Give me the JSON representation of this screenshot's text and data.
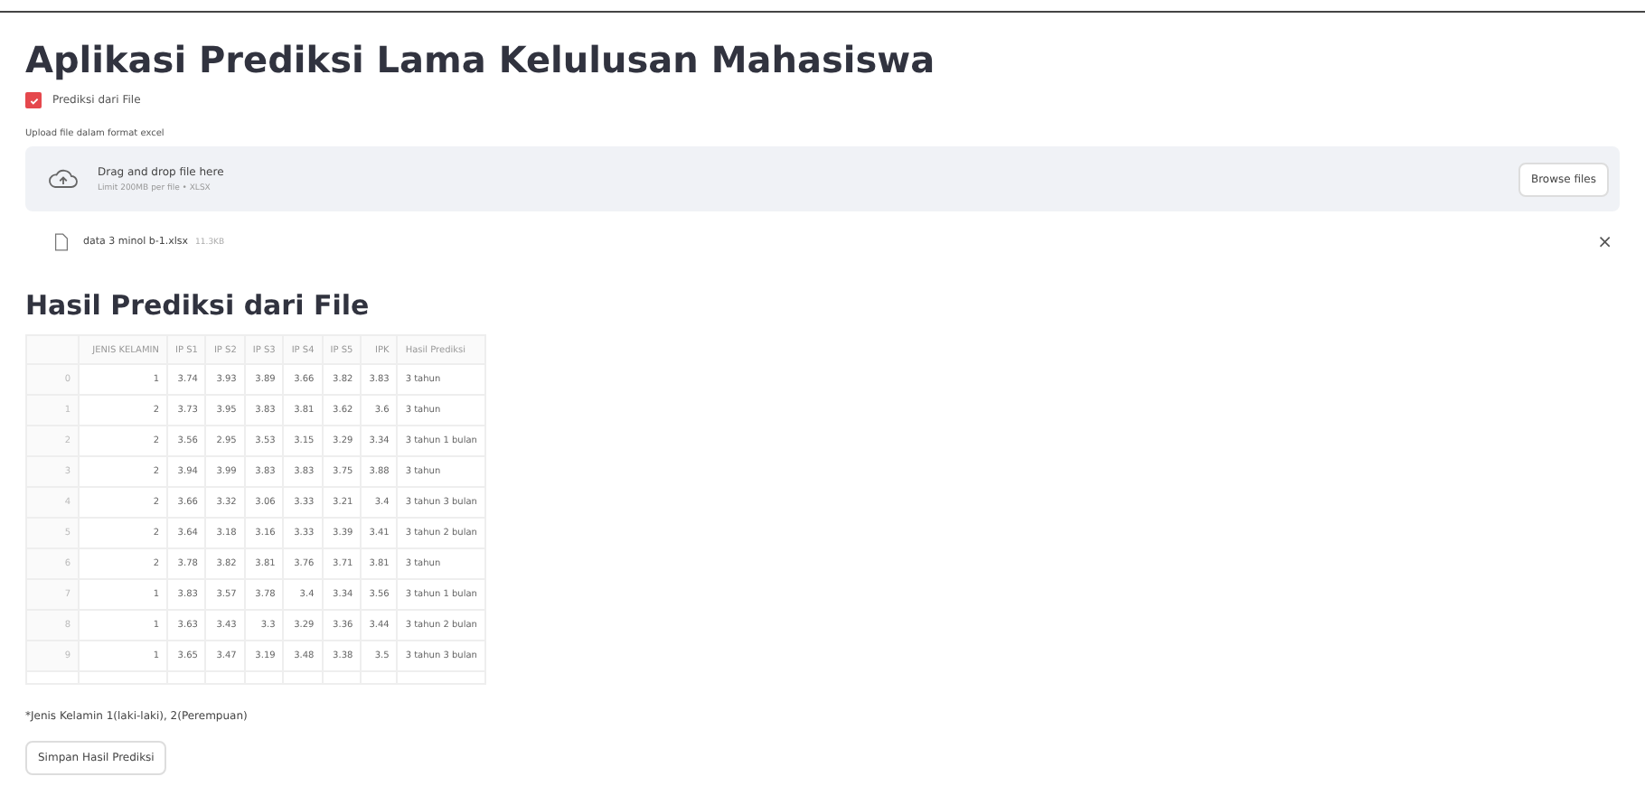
{
  "title": "Aplikasi Prediksi Lama Kelulusan Mahasiswa",
  "checkbox": {
    "label": "Prediksi dari File",
    "checked": true
  },
  "uploader": {
    "label": "Upload file dalam format excel",
    "drop_text": "Drag and drop file here",
    "limit": "Limit 200MB per file • XLSX",
    "button": "Browse files"
  },
  "file": {
    "name": "data 3 minol b-1.xlsx",
    "size": "11.3KB",
    "remove": "×"
  },
  "section_title": "Hasil Prediksi dari File",
  "table": {
    "columns": [
      "",
      "JENIS KELAMIN",
      "IP S1",
      "IP S2",
      "IP S3",
      "IP S4",
      "IP S5",
      "IPK",
      "Hasil Prediksi"
    ],
    "rows": [
      [
        "0",
        "1",
        "3.74",
        "3.93",
        "3.89",
        "3.66",
        "3.82",
        "3.83",
        "3 tahun"
      ],
      [
        "1",
        "2",
        "3.73",
        "3.95",
        "3.83",
        "3.81",
        "3.62",
        "3.6",
        "3 tahun"
      ],
      [
        "2",
        "2",
        "3.56",
        "2.95",
        "3.53",
        "3.15",
        "3.29",
        "3.34",
        "3 tahun 1 bulan"
      ],
      [
        "3",
        "2",
        "3.94",
        "3.99",
        "3.83",
        "3.83",
        "3.75",
        "3.88",
        "3 tahun"
      ],
      [
        "4",
        "2",
        "3.66",
        "3.32",
        "3.06",
        "3.33",
        "3.21",
        "3.4",
        "3 tahun 3 bulan"
      ],
      [
        "5",
        "2",
        "3.64",
        "3.18",
        "3.16",
        "3.33",
        "3.39",
        "3.41",
        "3 tahun 2 bulan"
      ],
      [
        "6",
        "2",
        "3.78",
        "3.82",
        "3.81",
        "3.76",
        "3.71",
        "3.81",
        "3 tahun"
      ],
      [
        "7",
        "1",
        "3.83",
        "3.57",
        "3.78",
        "3.4",
        "3.34",
        "3.56",
        "3 tahun 1 bulan"
      ],
      [
        "8",
        "1",
        "3.63",
        "3.43",
        "3.3",
        "3.29",
        "3.36",
        "3.44",
        "3 tahun 2 bulan"
      ],
      [
        "9",
        "1",
        "3.65",
        "3.47",
        "3.19",
        "3.48",
        "3.38",
        "3.5",
        "3 tahun 3 bulan"
      ]
    ]
  },
  "footnote": "*Jenis Kelamin 1(laki-laki), 2(Perempuan)",
  "save_button": "Simpan Hasil Prediksi"
}
